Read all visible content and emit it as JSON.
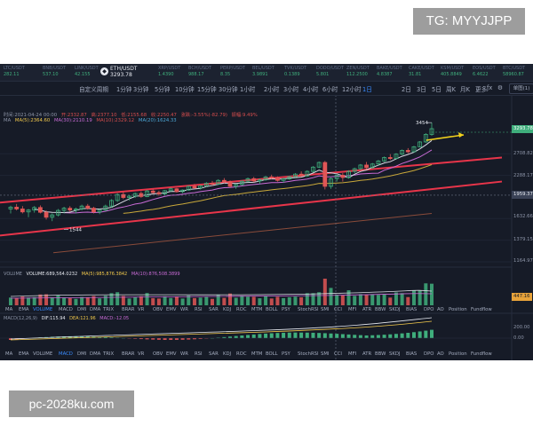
{
  "watermarks": {
    "top": "TG: MYYJJPP",
    "bottom": "pc-2028ku.com"
  },
  "tickers": [
    {
      "name": "LTC/USDT",
      "price": "282.11"
    },
    {
      "name": "BNB/USDT",
      "price": "537.10"
    },
    {
      "name": "LINK/USDT",
      "price": "42.155"
    },
    {
      "name": "ETH/USDT",
      "price": "3293.78",
      "active": true
    },
    {
      "name": "XRP/USDT",
      "price": "1.4390"
    },
    {
      "name": "BCH/USDT",
      "price": "988.17"
    },
    {
      "name": "PERP/USDT",
      "price": "8.35"
    },
    {
      "name": "BEL/USDT",
      "price": "3.9891"
    },
    {
      "name": "TVK/USDT",
      "price": "0.1389"
    },
    {
      "name": "DODO/USDT",
      "price": "5.801"
    },
    {
      "name": "ZEN/USDT",
      "price": "112.2500"
    },
    {
      "name": "BAKE/USDT",
      "price": "4.8387"
    },
    {
      "name": "CAKE/USDT",
      "price": "31.81"
    },
    {
      "name": "KSM/USDT",
      "price": "405.8849"
    },
    {
      "name": "EOS/USDT",
      "price": "6.4622"
    },
    {
      "name": "BTC/USDT",
      "price": "58960.87"
    }
  ],
  "timeframes": [
    "自定义周期",
    "1分钟",
    "3分钟",
    "5分钟",
    "10分钟",
    "15分钟",
    "30分钟",
    "1小时",
    "2小时",
    "3小时",
    "4小时",
    "6小时",
    "12小时",
    "1日",
    "2日",
    "3日",
    "5日",
    "周K",
    "月K"
  ],
  "active_timeframe": "1日",
  "more_icon_label": "更多",
  "layout_select": "单图(1)",
  "ohlc": {
    "time": "时间:2021-04-24 00:00",
    "open": "开:2332.87",
    "high": "高:2377.10",
    "low": "低:2155.68",
    "close": "收:2250.47",
    "change": "涨跌:-3.55%(-82.79)",
    "amplitude": "振幅:9.49%"
  },
  "ma_legend": {
    "label": "MA",
    "ma5": "MA(5):2364.60",
    "ma30": "MA(30):2110.19",
    "ma10": "MA(10):2329.12",
    "ma20": "MA(20):1624.33"
  },
  "price_axis": {
    "last": "3293.78",
    "ticks": [
      "2708.82",
      "2288.17",
      "1632.66",
      "1379.15",
      "1164.97"
    ],
    "crosshair": "1959.37"
  },
  "markers": {
    "high": "3454",
    "low": "1544"
  },
  "volume_legend": {
    "label": "VOLUME",
    "vol": "VOLUME:689,564.0232",
    "ma5": "MA(5):985,876.3842",
    "ma10": "MA(10):876,508.3899",
    "axis": "447.16"
  },
  "indicator_tabs": [
    "MA",
    "EMA",
    "VOLUME",
    "MACD",
    "DMI",
    "DMA",
    "TRIX",
    "BRAR",
    "VR",
    "OBV",
    "EMV",
    "WR",
    "RSI",
    "SAR",
    "KDJ",
    "ROC",
    "MTM",
    "BOLL",
    "PSY",
    "StochRSI",
    "SMI",
    "CCI",
    "MFI",
    "ATR",
    "BBW",
    "SKDJ",
    "BIAS",
    "DPO",
    "AO",
    "Position",
    "Fundflow"
  ],
  "active_tab_top": "VOLUME",
  "active_tab_bottom": "MACD",
  "macd_legend": {
    "label": "MACD(12,26,9)",
    "dif": "DIF:115.94",
    "dea": "DEA:121.96",
    "macd": "MACD:-12.05",
    "axis_top": "200.00",
    "axis_zero": "0.00"
  },
  "colors": {
    "up": "#3fae7c",
    "down": "#e05656",
    "channel": "#e8354a",
    "accent": "#3a8cff",
    "background": "#161b27"
  },
  "chart_data": {
    "type": "candlestick",
    "ohlc": [
      [
        1760,
        1805,
        1700,
        1785
      ],
      [
        1785,
        1830,
        1740,
        1760
      ],
      [
        1760,
        1800,
        1700,
        1720
      ],
      [
        1720,
        1760,
        1650,
        1745
      ],
      [
        1745,
        1800,
        1710,
        1780
      ],
      [
        1780,
        1810,
        1700,
        1715
      ],
      [
        1715,
        1740,
        1620,
        1650
      ],
      [
        1650,
        1700,
        1600,
        1680
      ],
      [
        1680,
        1760,
        1660,
        1740
      ],
      [
        1740,
        1790,
        1700,
        1770
      ],
      [
        1770,
        1800,
        1720,
        1745
      ],
      [
        1745,
        1780,
        1700,
        1760
      ],
      [
        1760,
        1820,
        1740,
        1800
      ],
      [
        1800,
        1830,
        1750,
        1770
      ],
      [
        1770,
        1790,
        1700,
        1720
      ],
      [
        1720,
        1760,
        1690,
        1745
      ],
      [
        1745,
        1820,
        1730,
        1800
      ],
      [
        1800,
        1900,
        1780,
        1880
      ],
      [
        1880,
        1990,
        1860,
        1970
      ],
      [
        1970,
        2010,
        1900,
        1925
      ],
      [
        1925,
        1960,
        1880,
        1945
      ],
      [
        1945,
        2000,
        1920,
        1985
      ],
      [
        1985,
        2020,
        1920,
        1940
      ],
      [
        1940,
        2040,
        1930,
        2025
      ],
      [
        2025,
        2060,
        1980,
        2000
      ],
      [
        2000,
        2030,
        1950,
        1980
      ],
      [
        1980,
        2040,
        1960,
        2030
      ],
      [
        2030,
        2080,
        2010,
        2060
      ],
      [
        2060,
        2075,
        2000,
        2015
      ],
      [
        2015,
        2050,
        1990,
        2040
      ],
      [
        2040,
        2110,
        2030,
        2100
      ],
      [
        2100,
        2140,
        2060,
        2075
      ],
      [
        2075,
        2120,
        2050,
        2110
      ],
      [
        2110,
        2170,
        2090,
        2150
      ],
      [
        2150,
        2190,
        2110,
        2135
      ],
      [
        2135,
        2220,
        2120,
        2200
      ],
      [
        2200,
        2240,
        2150,
        2175
      ],
      [
        2175,
        2200,
        2080,
        2100
      ],
      [
        2100,
        2140,
        2060,
        2130
      ],
      [
        2130,
        2200,
        2110,
        2185
      ],
      [
        2185,
        2250,
        2170,
        2230
      ],
      [
        2230,
        2260,
        2170,
        2190
      ],
      [
        2190,
        2230,
        2140,
        2210
      ],
      [
        2210,
        2280,
        2190,
        2260
      ],
      [
        2260,
        2300,
        2220,
        2240
      ],
      [
        2240,
        2270,
        2180,
        2200
      ],
      [
        2200,
        2240,
        2160,
        2225
      ],
      [
        2225,
        2280,
        2210,
        2265
      ],
      [
        2265,
        2330,
        2250,
        2310
      ],
      [
        2310,
        2360,
        2260,
        2280
      ],
      [
        2280,
        2380,
        2260,
        2360
      ],
      [
        2360,
        2460,
        2340,
        2440
      ],
      [
        2440,
        2550,
        2420,
        2530
      ],
      [
        2530,
        2560,
        2050,
        2100
      ],
      [
        2100,
        2250,
        2060,
        2230
      ],
      [
        2230,
        2300,
        2180,
        2290
      ],
      [
        2290,
        2330,
        2180,
        2250
      ],
      [
        2250,
        2380,
        2230,
        2360
      ],
      [
        2360,
        2430,
        2330,
        2410
      ],
      [
        2410,
        2500,
        2390,
        2480
      ],
      [
        2480,
        2540,
        2400,
        2430
      ],
      [
        2430,
        2520,
        2410,
        2500
      ],
      [
        2500,
        2580,
        2470,
        2560
      ],
      [
        2560,
        2650,
        2540,
        2630
      ],
      [
        2630,
        2700,
        2580,
        2610
      ],
      [
        2610,
        2720,
        2600,
        2700
      ],
      [
        2700,
        2800,
        2680,
        2780
      ],
      [
        2780,
        2830,
        2720,
        2750
      ],
      [
        2750,
        2880,
        2740,
        2860
      ],
      [
        2860,
        2990,
        2850,
        2970
      ],
      [
        2970,
        3180,
        2950,
        3150
      ],
      [
        3150,
        3454,
        3120,
        3293.78
      ]
    ],
    "annotations": {
      "high": 3454,
      "low": 1544
    }
  }
}
